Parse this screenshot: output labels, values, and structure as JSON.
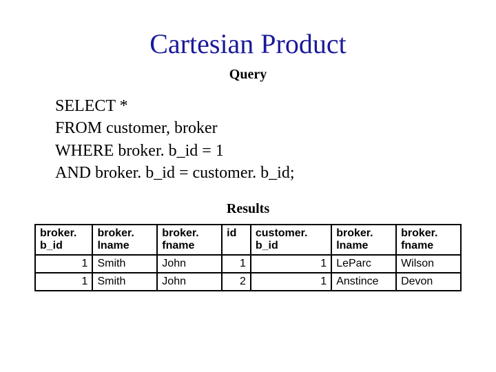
{
  "title": "Cartesian Product",
  "query_label": "Query",
  "query_lines": {
    "l0": "SELECT *",
    "l1": "FROM customer, broker",
    "l2": "WHERE broker. b_id = 1",
    "l3": "AND broker. b_id = customer. b_id;"
  },
  "results_label": "Results",
  "headers": {
    "h0a": "broker.",
    "h0b": "b_id",
    "h1a": "broker.",
    "h1b": "lname",
    "h2a": "broker.",
    "h2b": "fname",
    "h3a": "id",
    "h3b": "",
    "h4a": "customer.",
    "h4b": "b_id",
    "h5a": "broker.",
    "h5b": "lname",
    "h6a": "broker.",
    "h6b": "fname"
  },
  "rows": [
    {
      "c0": "1",
      "c1": "Smith",
      "c2": "John",
      "c3": "1",
      "c4": "1",
      "c5": "LeParc",
      "c6": "Wilson"
    },
    {
      "c0": "1",
      "c1": "Smith",
      "c2": "John",
      "c3": "2",
      "c4": "1",
      "c5": "Anstince",
      "c6": "Devon"
    }
  ]
}
